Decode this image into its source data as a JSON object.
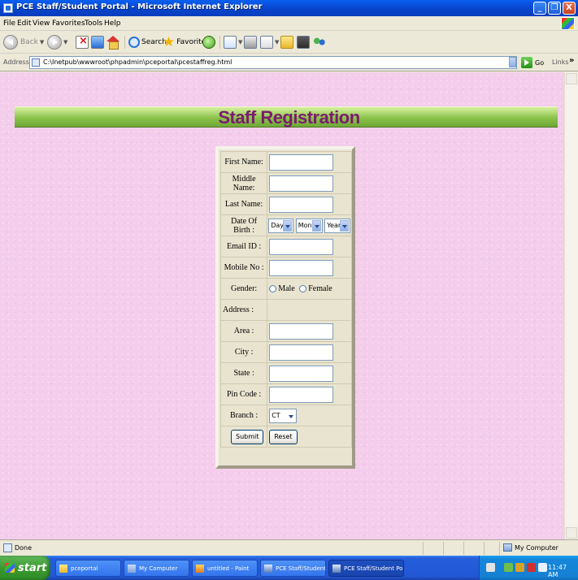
{
  "window": {
    "title": "PCE Staff/Student Portal - Microsoft Internet Explorer",
    "minimize": "_",
    "maximize": "❐",
    "close": "X"
  },
  "menu": [
    "File",
    "Edit",
    "View",
    "Favorites",
    "Tools",
    "Help"
  ],
  "toolbar": {
    "back_label": "Back",
    "search_label": "Search",
    "favorites_label": "Favorites"
  },
  "address": {
    "label": "Address",
    "url": "C:\\Inetpub\\wwwroot\\phpadmin\\pceportal\\pcestaffreg.html",
    "go_label": "Go",
    "links_label": "Links",
    "links_chevron": "»"
  },
  "page": {
    "title": "Staff Registration"
  },
  "form": {
    "first_name_label": "First Name:",
    "middle_name_label": "Middle Name:",
    "last_name_label": "Last Name:",
    "dob_label": "Date Of Birth :",
    "dob_day": "Day",
    "dob_month": "Month",
    "dob_year": "Year",
    "email_label": "Email ID :",
    "mobile_label": "Mobile No :",
    "gender_label": "Gender:",
    "gender_male": "Male",
    "gender_female": "Female",
    "address_label": "Address :",
    "area_label": "Area :",
    "city_label": "City :",
    "state_label": "State :",
    "pincode_label": "Pin Code :",
    "branch_label": "Branch :",
    "branch_value": "CT",
    "submit_label": "Submit",
    "reset_label": "Reset"
  },
  "status": {
    "text": "Done",
    "zone": "My Computer"
  },
  "taskbar": {
    "start": "start",
    "items": [
      "pceportal",
      "My Computer",
      "untitled - Paint",
      "PCE Staff/Student Po...",
      "PCE Staff/Student Po..."
    ],
    "clock": "11:47 AM"
  },
  "colors": {
    "page_background": "#f3cdeb",
    "banner_green": "#8bc34a",
    "title_purple": "#7b1c6f"
  }
}
